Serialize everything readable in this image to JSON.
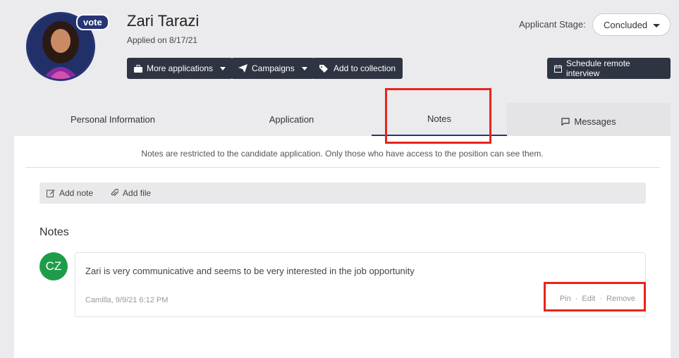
{
  "header": {
    "vote_badge": "vote",
    "candidate_name": "Zari Tarazi",
    "applied_on": "Applied on 8/17/21",
    "stage_label": "Applicant Stage:",
    "stage_value": "Concluded"
  },
  "actions": {
    "more_applications": "More applications",
    "campaigns": "Campaigns",
    "add_to_collection": "Add to collection",
    "schedule_interview": "Schedule remote interview"
  },
  "tabs": [
    {
      "label": "Personal Information"
    },
    {
      "label": "Application"
    },
    {
      "label": "Notes"
    },
    {
      "label": "Messages"
    }
  ],
  "notes_panel": {
    "restriction_text": "Notes are restricted to the candidate application. Only those who have access to the position can see them.",
    "add_note": "Add note",
    "add_file": "Add file",
    "heading": "Notes",
    "note": {
      "author_initials": "CZ",
      "text": "Zari is very communicative and seems to be very interested in the job opportunity",
      "meta": "Camilla, 9/9/21 6:12 PM",
      "pin": "Pin",
      "edit": "Edit",
      "remove": "Remove",
      "separator": "·"
    }
  },
  "colors": {
    "accent": "#263575",
    "dark_button": "#2f3442",
    "avatar_green": "#1e9c4a",
    "highlight": "#e8241b"
  }
}
